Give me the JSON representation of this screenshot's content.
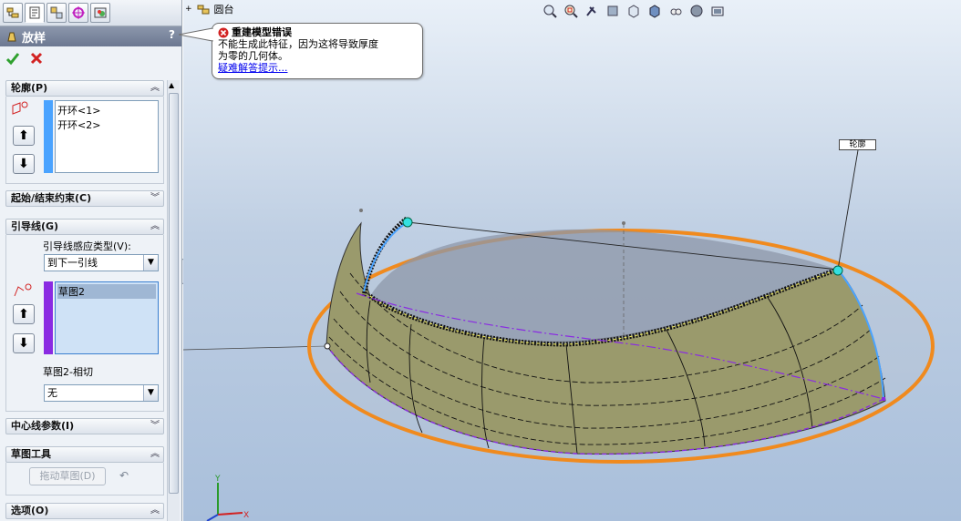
{
  "property_manager": {
    "title": "放样",
    "help": "?",
    "profiles": {
      "header": "轮廓(P)",
      "items": [
        "开环<1>",
        "开环<2>"
      ]
    },
    "start_end": {
      "header": "起始/结束约束(C)"
    },
    "guides": {
      "header": "引导线(G)",
      "influence_label": "引导线感应类型(V):",
      "influence_value": "到下一引线",
      "items": [
        "草图2"
      ],
      "tangency_label": "草图2-相切",
      "tangency_value": "无"
    },
    "centerline": {
      "header": "中心线参数(I)"
    },
    "sketch_tools": {
      "header": "草图工具",
      "drag_button": "拖动草图(D)"
    },
    "options": {
      "header": "选项(O)"
    }
  },
  "viewport": {
    "tree_item": "圆台",
    "error": {
      "title": "重建模型错误",
      "line1": "不能生成此特征，因为这将导致厚度",
      "line2": "为零的几何体。",
      "link": "疑难解答提示..."
    },
    "profile_callout": "轮廓"
  },
  "colors": {
    "accent_orange": "#f08a1e",
    "surface": "#9a9a6c",
    "guide_purple": "#8a2be2",
    "profile_blue": "#4aa3ff",
    "error_red": "#d22222"
  }
}
